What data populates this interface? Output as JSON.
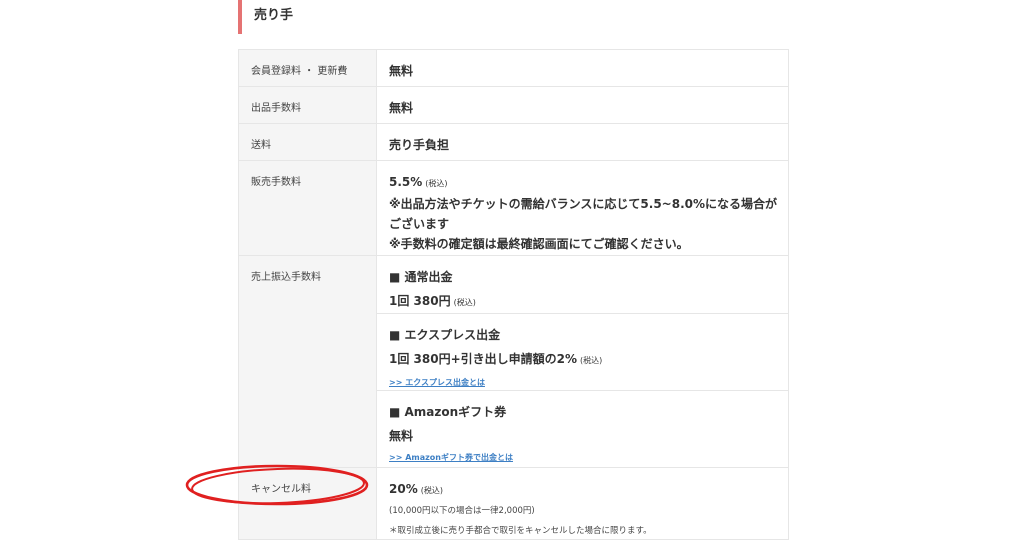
{
  "section": {
    "title": "売り手"
  },
  "rows": {
    "member": {
      "label": "会員登録料 ・ 更新費",
      "value": "無料"
    },
    "listing": {
      "label": "出品手数料",
      "value": "無料"
    },
    "shipping": {
      "label": "送料",
      "value": "売り手負担"
    },
    "sales": {
      "label": "販売手数料",
      "rate": "5.5%",
      "tax": "(税込)",
      "note1a": "※出品方法やチケットの需給バランスに応じて5.5~8.0%になる場合が",
      "note1b": "ございます",
      "note2": "※手数料の確定額は最終確認画面にてご確認ください。"
    },
    "transfer": {
      "label": "売上振込手数料",
      "normal": {
        "heading": "■ 通常出金",
        "price": "1回 380円",
        "tax": "(税込)"
      },
      "express": {
        "heading": "■ エクスプレス出金",
        "price": "1回 380円+引き出し申請額の2%",
        "tax": "(税込)",
        "link": ">> エクスプレス出金とは"
      },
      "amazon": {
        "heading": "■ Amazonギフト券",
        "price": "無料",
        "link": ">> Amazonギフト券で出金とは"
      }
    },
    "cancel": {
      "label": "キャンセル料",
      "rate": "20%",
      "tax": "(税込)",
      "note1": "(10,000円以下の場合は一律2,000円)",
      "note2": "＊取引成立後に売り手都合で取引をキャンセルした場合に限ります。"
    }
  },
  "annotation": {
    "color": "#e02020"
  }
}
